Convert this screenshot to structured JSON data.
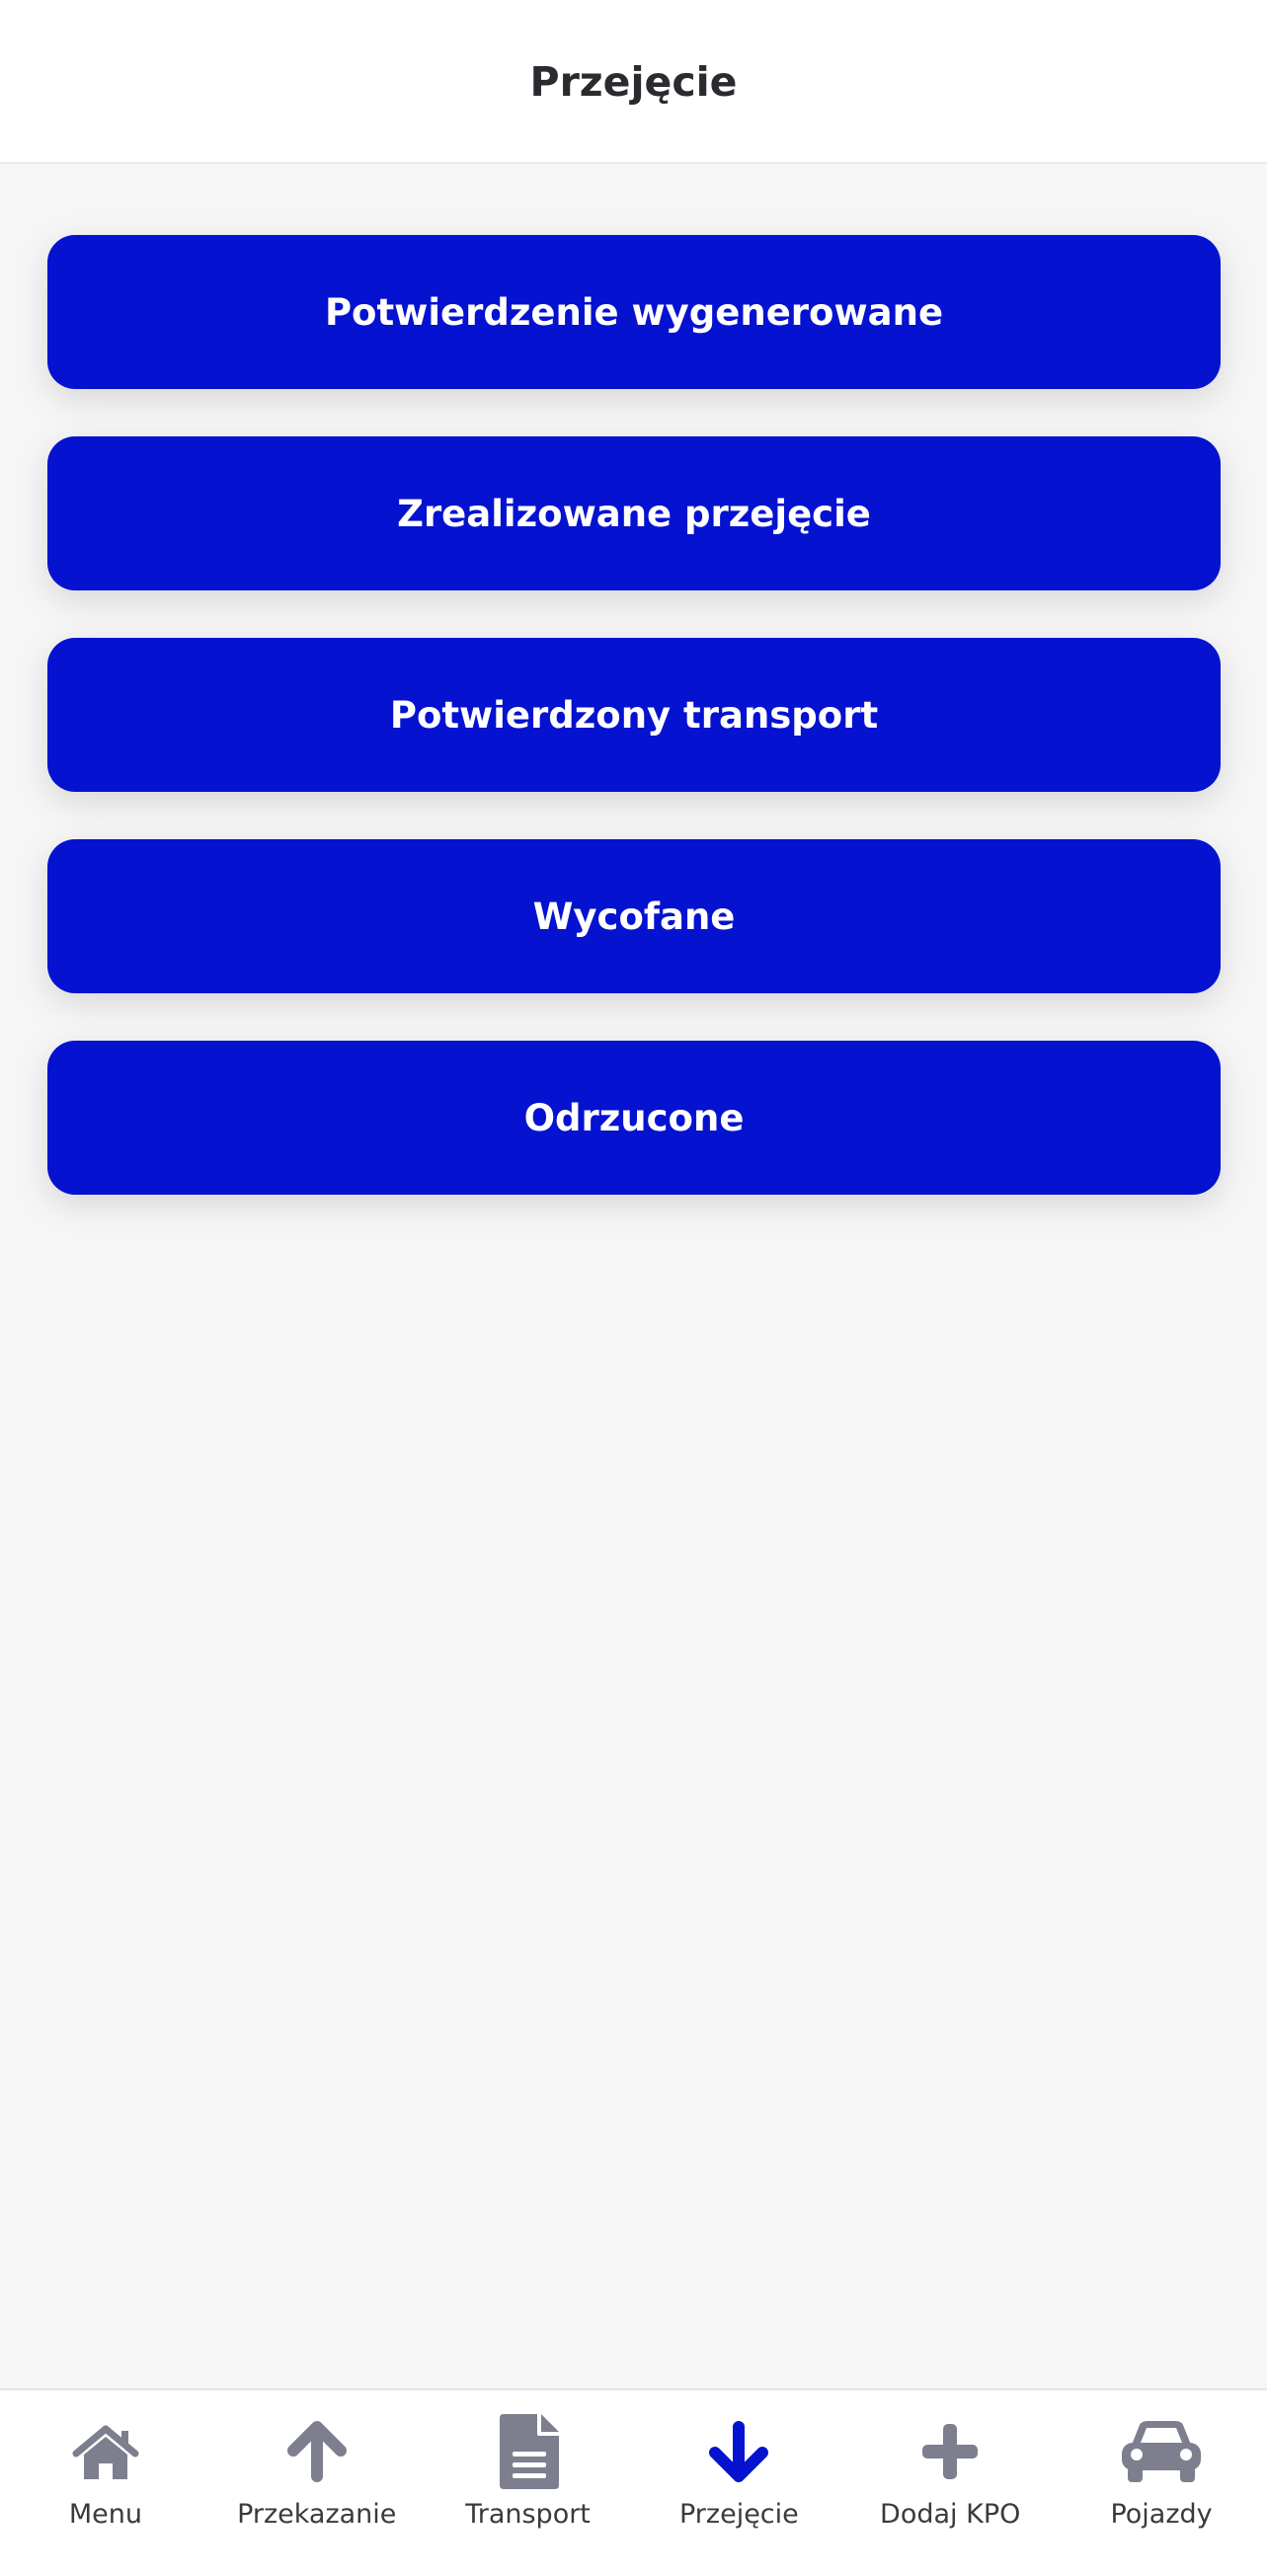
{
  "header": {
    "title": "Przejęcie"
  },
  "status_buttons": [
    {
      "label": "Potwierdzenie wygenerowane"
    },
    {
      "label": "Zrealizowane przejęcie"
    },
    {
      "label": "Potwierdzony transport"
    },
    {
      "label": "Wycofane"
    },
    {
      "label": "Odrzucone"
    }
  ],
  "tabbar": {
    "items": [
      {
        "label": "Menu",
        "icon": "home-icon",
        "active": false
      },
      {
        "label": "Przekazanie",
        "icon": "arrow-up-icon",
        "active": false
      },
      {
        "label": "Transport",
        "icon": "document-icon",
        "active": false
      },
      {
        "label": "Przejęcie",
        "icon": "arrow-down-icon",
        "active": true
      },
      {
        "label": "Dodaj KPO",
        "icon": "plus-icon",
        "active": false
      },
      {
        "label": "Pojazdy",
        "icon": "car-icon",
        "active": false
      }
    ]
  },
  "colors": {
    "accent": "#0512cf",
    "icon_inactive": "#7d7f8e",
    "background": "#f6f6f6",
    "header_background": "#ffffff",
    "title_text": "#2b2b2f"
  }
}
